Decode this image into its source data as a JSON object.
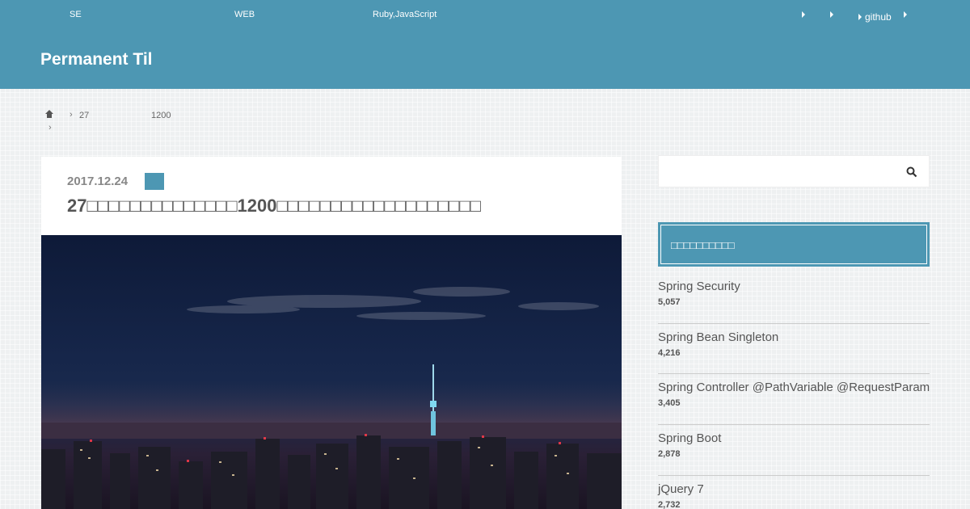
{
  "header": {
    "nav_left": [
      "SE",
      "WEB",
      "Ruby,JavaScript"
    ],
    "nav_right": [
      "",
      "",
      "github",
      ""
    ],
    "site_title": "Permanent Til",
    "color": "#4d97b3"
  },
  "breadcrumb": {
    "items": [
      "27",
      "1200"
    ]
  },
  "article": {
    "date": "2017.12.24",
    "title": "27□□□□□□□□□□□□□□1200□□□□□□□□□□□□□□□□□□□"
  },
  "sidebar": {
    "search": {
      "placeholder": ""
    },
    "widget_title": "□□□□□□□□□□",
    "popular": [
      {
        "title": "Spring Security",
        "views": "5,057"
      },
      {
        "title": "Spring Bean   Singleton",
        "views": "4,216"
      },
      {
        "title": "Spring Controller   @PathVariable   @RequestParam",
        "views": "3,405"
      },
      {
        "title": "Spring Boot",
        "views": "2,878"
      },
      {
        "title": "jQuery                7",
        "views": "2,732"
      }
    ]
  },
  "icons": {
    "home": "home-icon",
    "search": "search-icon",
    "caret": "caret-right-icon"
  }
}
